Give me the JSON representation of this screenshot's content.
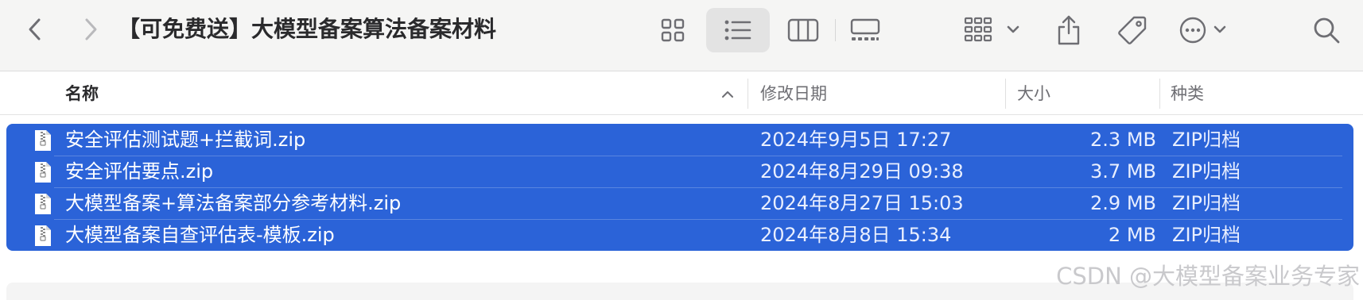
{
  "window": {
    "title": "【可免费送】大模型备案算法备案材料"
  },
  "toolbar": {
    "icons": [
      "chevron-left-icon",
      "chevron-right-icon",
      "icon-view-icon",
      "list-view-icon",
      "column-view-icon",
      "gallery-view-icon",
      "group-icon",
      "share-icon",
      "tag-icon",
      "more-icon",
      "search-icon"
    ],
    "active_view": "list"
  },
  "columns": {
    "name": "名称",
    "date": "修改日期",
    "size": "大小",
    "kind": "种类"
  },
  "files": [
    {
      "name": "安全评估测试题+拦截词.zip",
      "date": "2024年9月5日 17:27",
      "size": "2.3 MB",
      "kind": "ZIP归档"
    },
    {
      "name": "安全评估要点.zip",
      "date": "2024年8月29日 09:38",
      "size": "3.7 MB",
      "kind": "ZIP归档"
    },
    {
      "name": "大模型备案+算法备案部分参考材料.zip",
      "date": "2024年8月27日 15:03",
      "size": "2.9 MB",
      "kind": "ZIP归档"
    },
    {
      "name": "大模型备案自查评估表-模板.zip",
      "date": "2024年8月8日 15:34",
      "size": "2 MB",
      "kind": "ZIP归档"
    }
  ],
  "colors": {
    "selection": "#2b63d8",
    "toolbar_bg": "#f5f5f4"
  },
  "watermark": "CSDN @大模型备案业务专家"
}
